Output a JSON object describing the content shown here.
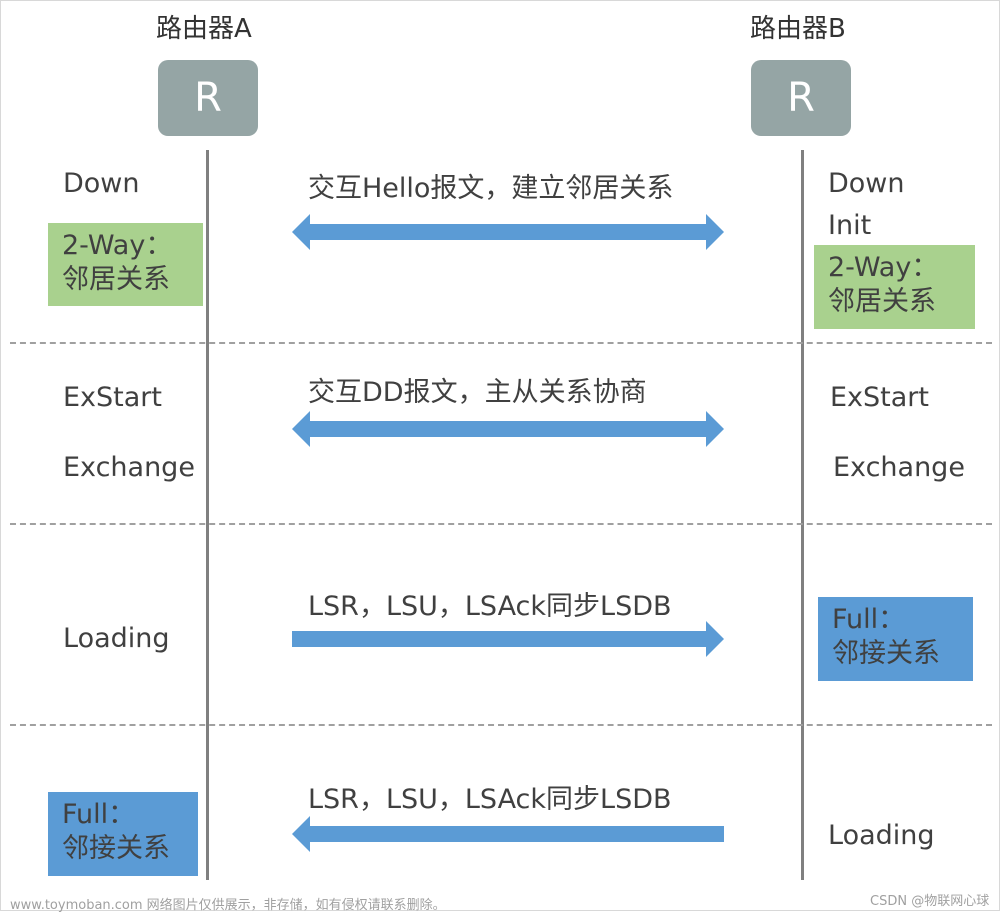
{
  "routers": {
    "a": {
      "title": "路由器A",
      "label": "R"
    },
    "b": {
      "title": "路由器B",
      "label": "R"
    }
  },
  "colors": {
    "router_box": "#95a5a5",
    "arrow": "#5b9bd5",
    "badge_green": "#a9d18e",
    "badge_blue": "#5b9bd5",
    "lifeline": "#808080",
    "divider": "#a0a0a0"
  },
  "phases": [
    {
      "message": "交互Hello报文，建立邻居关系",
      "direction": "both",
      "router_a": {
        "states": [
          "Down"
        ],
        "badge": {
          "line1": "2-Way：",
          "line2": "邻居关系",
          "color": "green"
        }
      },
      "router_b": {
        "states": [
          "Down",
          "Init"
        ],
        "badge": {
          "line1": "2-Way：",
          "line2": "邻居关系",
          "color": "green"
        }
      }
    },
    {
      "message": "交互DD报文，主从关系协商",
      "direction": "both",
      "router_a": {
        "states": [
          "ExStart",
          "Exchange"
        ]
      },
      "router_b": {
        "states": [
          "ExStart",
          "Exchange"
        ]
      }
    },
    {
      "message": "LSR，LSU，LSAck同步LSDB",
      "direction": "a-to-b",
      "router_a": {
        "states": [
          "Loading"
        ]
      },
      "router_b": {
        "badge": {
          "line1": "Full：",
          "line2": "邻接关系",
          "color": "blue"
        }
      }
    },
    {
      "message": "LSR，LSU，LSAck同步LSDB",
      "direction": "b-to-a",
      "router_a": {
        "badge": {
          "line1": "Full：",
          "line2": "邻接关系",
          "color": "blue"
        }
      },
      "router_b": {
        "states": [
          "Loading"
        ]
      }
    }
  ],
  "watermarks": {
    "left": "www.toymoban.com 网络图片仅供展示，非存储，如有侵权请联系删除。",
    "right": "CSDN @物联网心球"
  }
}
